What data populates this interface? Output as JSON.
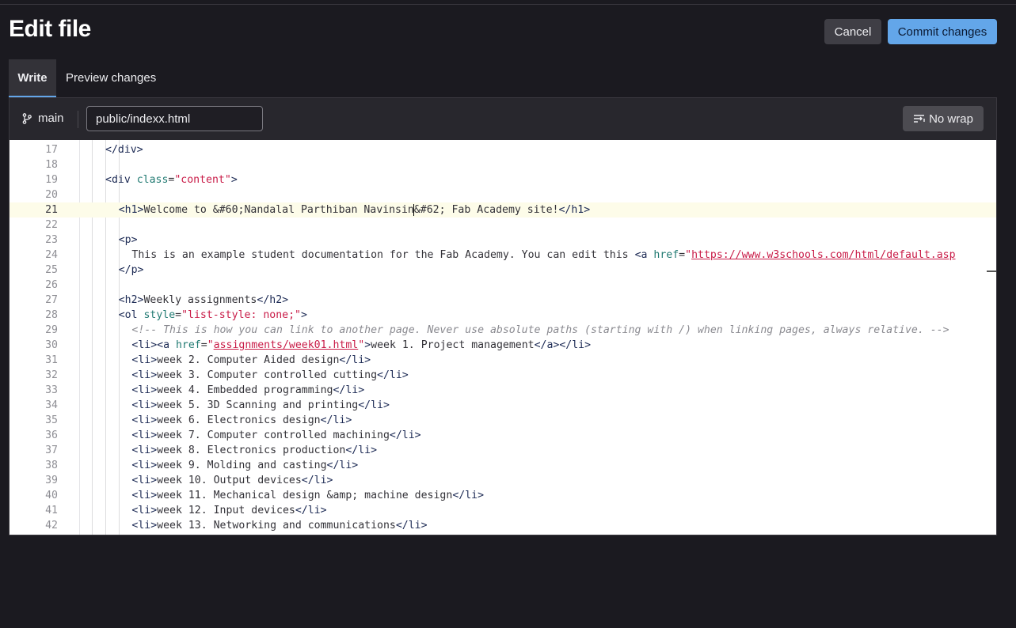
{
  "page": {
    "title": "Edit file"
  },
  "actions": {
    "cancel_label": "Cancel",
    "commit_label": "Commit changes"
  },
  "tabs": [
    {
      "label": "Write",
      "active": true
    },
    {
      "label": "Preview changes",
      "active": false
    }
  ],
  "editor": {
    "branch": "main",
    "filename": "public/indexx.html",
    "wrap_label": "No wrap",
    "current_line": 21
  },
  "lines": [
    {
      "n": "17",
      "indent": 2,
      "tokens": [
        [
          "tag",
          "</div>"
        ]
      ]
    },
    {
      "n": "18",
      "indent": 0,
      "tokens": []
    },
    {
      "n": "19",
      "indent": 2,
      "tokens": [
        [
          "tag",
          "<div "
        ],
        [
          "attr",
          "class"
        ],
        [
          "plain",
          "="
        ],
        [
          "str",
          "\"content\""
        ],
        [
          "tag",
          ">"
        ]
      ]
    },
    {
      "n": "20",
      "indent": 0,
      "tokens": []
    },
    {
      "n": "21",
      "indent": 4,
      "tokens": [
        [
          "tag",
          "<h1>"
        ],
        [
          "plain",
          "Welcome to &#60;Nandalal Parthiban Navinsin"
        ],
        [
          "caret",
          ""
        ],
        [
          "plain",
          "&#62; Fab Academy site!"
        ],
        [
          "tag",
          "</h1>"
        ]
      ]
    },
    {
      "n": "22",
      "indent": 0,
      "tokens": []
    },
    {
      "n": "23",
      "indent": 4,
      "tokens": [
        [
          "tag",
          "<p>"
        ]
      ]
    },
    {
      "n": "24",
      "indent": 6,
      "tokens": [
        [
          "plain",
          "This is an example student documentation for the Fab Academy. You can edit this "
        ],
        [
          "tag",
          "<a "
        ],
        [
          "attr",
          "href"
        ],
        [
          "plain",
          "="
        ],
        [
          "str",
          "\""
        ],
        [
          "link",
          "https://www.w3schools.com/html/default.asp"
        ]
      ]
    },
    {
      "n": "25",
      "indent": 4,
      "tokens": [
        [
          "tag",
          "</p>"
        ]
      ]
    },
    {
      "n": "26",
      "indent": 0,
      "tokens": []
    },
    {
      "n": "27",
      "indent": 4,
      "tokens": [
        [
          "tag",
          "<h2>"
        ],
        [
          "plain",
          "Weekly assignments"
        ],
        [
          "tag",
          "</h2>"
        ]
      ]
    },
    {
      "n": "28",
      "indent": 4,
      "tokens": [
        [
          "tag",
          "<ol "
        ],
        [
          "attr",
          "style"
        ],
        [
          "plain",
          "="
        ],
        [
          "str",
          "\"list-style: none;\""
        ],
        [
          "tag",
          ">"
        ]
      ]
    },
    {
      "n": "29",
      "indent": 6,
      "tokens": [
        [
          "cmt",
          "<!-- This is how you can link to another page. Never use absolute paths (starting with /) when linking pages, always relative. -->"
        ]
      ]
    },
    {
      "n": "30",
      "indent": 6,
      "tokens": [
        [
          "tag",
          "<li><a "
        ],
        [
          "attr",
          "href"
        ],
        [
          "plain",
          "="
        ],
        [
          "str",
          "\""
        ],
        [
          "link",
          "assignments/week01.html"
        ],
        [
          "str",
          "\""
        ],
        [
          "tag",
          ">"
        ],
        [
          "plain",
          "week 1. Project management"
        ],
        [
          "tag",
          "</a></li>"
        ]
      ]
    },
    {
      "n": "31",
      "indent": 6,
      "tokens": [
        [
          "tag",
          "<li>"
        ],
        [
          "plain",
          "week 2. Computer Aided design"
        ],
        [
          "tag",
          "</li>"
        ]
      ]
    },
    {
      "n": "32",
      "indent": 6,
      "tokens": [
        [
          "tag",
          "<li>"
        ],
        [
          "plain",
          "week 3. Computer controlled cutting"
        ],
        [
          "tag",
          "</li>"
        ]
      ]
    },
    {
      "n": "33",
      "indent": 6,
      "tokens": [
        [
          "tag",
          "<li>"
        ],
        [
          "plain",
          "week 4. Embedded programming"
        ],
        [
          "tag",
          "</li>"
        ]
      ]
    },
    {
      "n": "34",
      "indent": 6,
      "tokens": [
        [
          "tag",
          "<li>"
        ],
        [
          "plain",
          "week 5. 3D Scanning and printing"
        ],
        [
          "tag",
          "</li>"
        ]
      ]
    },
    {
      "n": "35",
      "indent": 6,
      "tokens": [
        [
          "tag",
          "<li>"
        ],
        [
          "plain",
          "week 6. Electronics design"
        ],
        [
          "tag",
          "</li>"
        ]
      ]
    },
    {
      "n": "36",
      "indent": 6,
      "tokens": [
        [
          "tag",
          "<li>"
        ],
        [
          "plain",
          "week 7. Computer controlled machining"
        ],
        [
          "tag",
          "</li>"
        ]
      ]
    },
    {
      "n": "37",
      "indent": 6,
      "tokens": [
        [
          "tag",
          "<li>"
        ],
        [
          "plain",
          "week 8. Electronics production"
        ],
        [
          "tag",
          "</li>"
        ]
      ]
    },
    {
      "n": "38",
      "indent": 6,
      "tokens": [
        [
          "tag",
          "<li>"
        ],
        [
          "plain",
          "week 9. Molding and casting"
        ],
        [
          "tag",
          "</li>"
        ]
      ]
    },
    {
      "n": "39",
      "indent": 6,
      "tokens": [
        [
          "tag",
          "<li>"
        ],
        [
          "plain",
          "week 10. Output devices"
        ],
        [
          "tag",
          "</li>"
        ]
      ]
    },
    {
      "n": "40",
      "indent": 6,
      "tokens": [
        [
          "tag",
          "<li>"
        ],
        [
          "plain",
          "week 11. Mechanical design &amp; machine design"
        ],
        [
          "tag",
          "</li>"
        ]
      ]
    },
    {
      "n": "41",
      "indent": 6,
      "tokens": [
        [
          "tag",
          "<li>"
        ],
        [
          "plain",
          "week 12. Input devices"
        ],
        [
          "tag",
          "</li>"
        ]
      ]
    },
    {
      "n": "42",
      "indent": 6,
      "tokens": [
        [
          "tag",
          "<li>"
        ],
        [
          "plain",
          "week 13. Networking and communications"
        ],
        [
          "tag",
          "</li>"
        ]
      ]
    }
  ]
}
